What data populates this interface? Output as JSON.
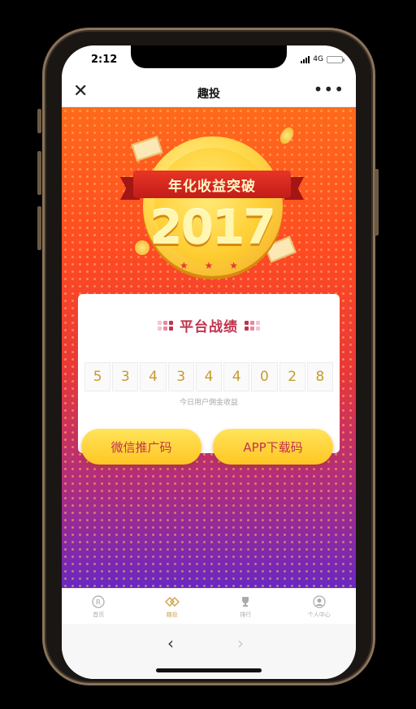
{
  "status_bar": {
    "time": "2:12",
    "network": "4G",
    "battery_level": 0.2
  },
  "nav": {
    "title": "趣投"
  },
  "banner": {
    "ribbon_text": "年化收益突破",
    "year": "2017",
    "stars": "★ ★ ★"
  },
  "stats_card": {
    "title": "平台战绩",
    "digits": [
      "5",
      "3",
      "4",
      "3",
      "4",
      "4",
      "0",
      "2",
      "8"
    ],
    "caption": "今日用户佣金收益"
  },
  "buttons": {
    "wechat_code": "微信推广码",
    "app_download": "APP下载码"
  },
  "tabs": [
    {
      "icon": "registered-icon",
      "label": "首页"
    },
    {
      "icon": "invest-icon",
      "label": "趣投"
    },
    {
      "icon": "trophy-icon",
      "label": "排行"
    },
    {
      "icon": "user-icon",
      "label": "个人中心"
    }
  ],
  "colors": {
    "accent_red": "#c0334d",
    "gold": "#ffc624",
    "gradient_top": "#ff6a1c",
    "gradient_bottom": "#6a27c2"
  }
}
